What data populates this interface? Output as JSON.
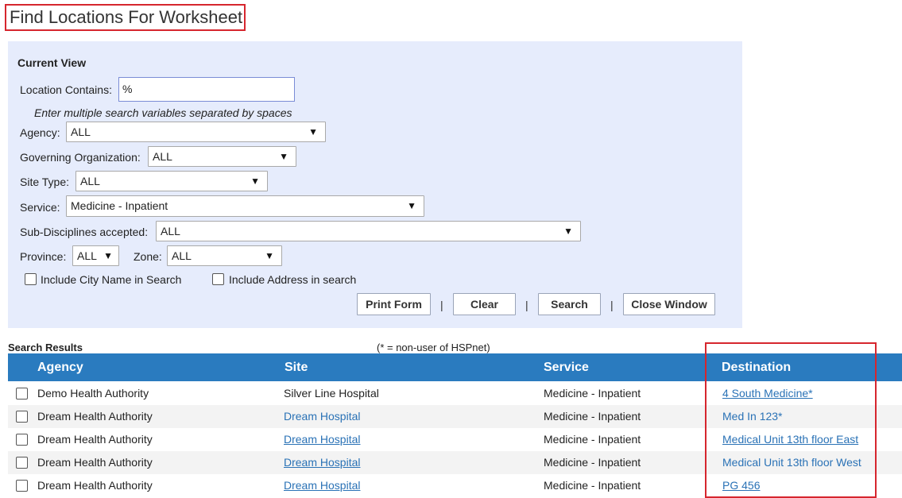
{
  "page": {
    "title": "Find Locations For Worksheet"
  },
  "form": {
    "section_title": "Current View",
    "location_label": "Location Contains:",
    "location_value": "%",
    "hint": "Enter multiple search variables separated by spaces",
    "agency_label": "Agency:",
    "agency_value": "ALL",
    "governing_label": "Governing Organization:",
    "governing_value": "ALL",
    "site_type_label": "Site Type:",
    "site_type_value": "ALL",
    "service_label": "Service:",
    "service_value": "Medicine - Inpatient",
    "subdisc_label": "Sub-Disciplines accepted:",
    "subdisc_value": "ALL",
    "province_label": "Province:",
    "province_value": "ALL",
    "zone_label": "Zone:",
    "zone_value": "ALL",
    "include_city_label": "Include City Name in Search",
    "include_address_label": "Include Address in search",
    "buttons": {
      "print": "Print Form",
      "clear": "Clear",
      "search": "Search",
      "close": "Close Window",
      "separator": "|"
    }
  },
  "results": {
    "title": "Search Results",
    "note": "(* = non-user of HSPnet)",
    "columns": [
      "Agency",
      "Site",
      "Service",
      "Destination"
    ],
    "rows": [
      {
        "agency": "Demo Health Authority",
        "site": "Silver Line Hospital",
        "service": "Medicine - Inpatient",
        "destination": "4 South Medicine*"
      },
      {
        "agency": "Dream Health Authority",
        "site": "Dream Hospital",
        "service": "Medicine - Inpatient",
        "destination": "Med In 123*"
      },
      {
        "agency": "Dream Health Authority",
        "site": "Dream Hospital",
        "service": "Medicine - Inpatient",
        "destination": "Medical Unit 13th floor East"
      },
      {
        "agency": "Dream Health Authority",
        "site": "Dream Hospital",
        "service": "Medicine - Inpatient",
        "destination": "Medical Unit 13th floor West"
      },
      {
        "agency": "Dream Health Authority",
        "site": "Dream Hospital",
        "service": "Medicine - Inpatient",
        "destination": "PG 456"
      }
    ]
  },
  "colors": {
    "highlight": "#d6262e",
    "header_bg": "#2a7bbf",
    "panel_bg": "#e6ecfc",
    "link": "#2a72b6"
  },
  "icons": {
    "dropdown": "triangle-down-icon",
    "checkbox": "checkbox-icon"
  }
}
